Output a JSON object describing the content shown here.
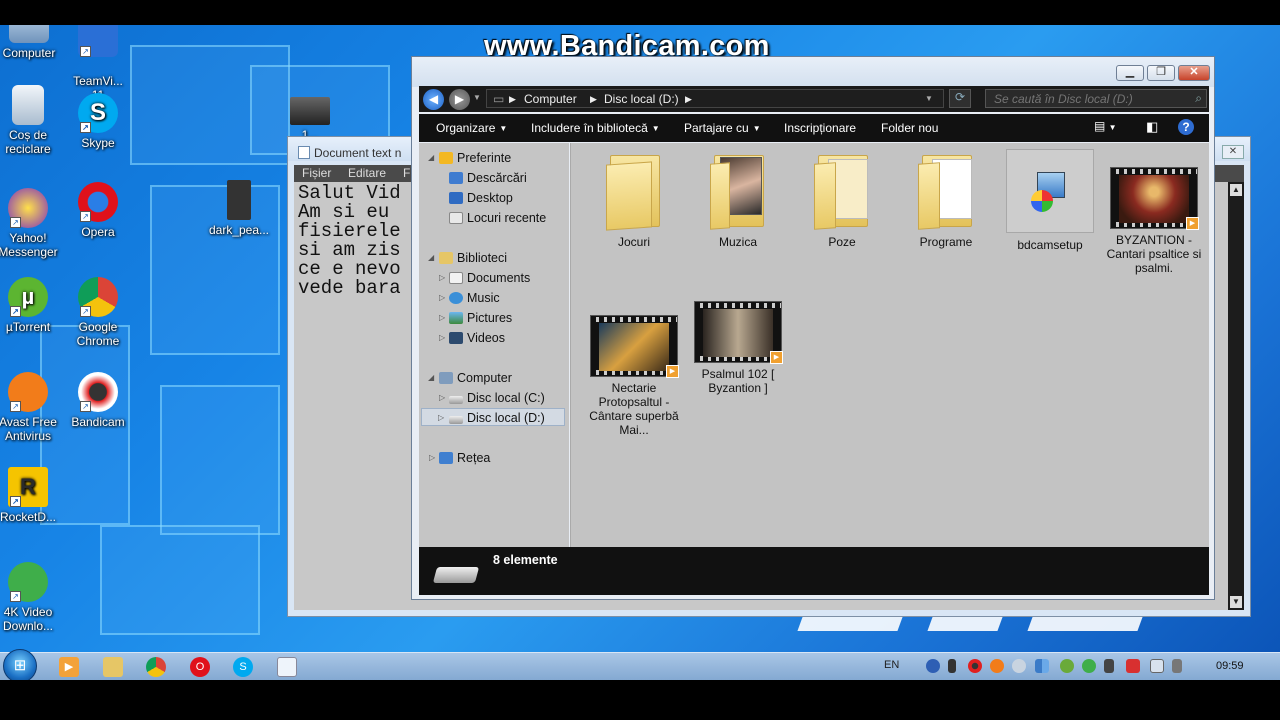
{
  "watermark": "www.Bandicam.com",
  "desktop_icons": [
    {
      "id": "computer",
      "label": "Computer",
      "icon": "computer-icon"
    },
    {
      "id": "teamviewer",
      "label": "TeamVi...\n11",
      "icon": "teamviewer-icon"
    },
    {
      "id": "recycle",
      "label": "Coș de\nreciclare",
      "icon": "recycle-bin-icon"
    },
    {
      "id": "skype",
      "label": "Skype",
      "icon": "skype-icon"
    },
    {
      "id": "yahoo",
      "label": "Yahoo!\nMessenger",
      "icon": "yahoo-messenger-icon"
    },
    {
      "id": "opera",
      "label": "Opera",
      "icon": "opera-icon"
    },
    {
      "id": "darkpea",
      "label": "dark_pea...",
      "icon": "file-icon"
    },
    {
      "id": "utorrent",
      "label": "µTorrent",
      "icon": "utorrent-icon"
    },
    {
      "id": "chrome",
      "label": "Google\nChrome",
      "icon": "chrome-icon"
    },
    {
      "id": "avast",
      "label": "Avast Free\nAntivirus",
      "icon": "avast-icon"
    },
    {
      "id": "bandicam",
      "label": "Bandicam",
      "icon": "bandicam-icon"
    },
    {
      "id": "rocketdock",
      "label": "RocketD...",
      "icon": "rocketdock-icon"
    },
    {
      "id": "4kvideo",
      "label": "4K Video\nDownlo...",
      "icon": "4k-video-downloader-icon"
    },
    {
      "id": "partial",
      "label": "1...",
      "icon": "media-file-icon"
    }
  ],
  "notepad": {
    "title": "Document text n",
    "menu": [
      "Fișier",
      "Editare",
      "F"
    ],
    "text": "Salut Vid\nAm si eu\nfisierele\nsi am zis\nce e nevo\nvede bara"
  },
  "explorer": {
    "breadcrumb": [
      "Computer",
      "Disc local (D:)"
    ],
    "search_placeholder": "Se caută în Disc local (D:)",
    "toolbar": {
      "organize": "Organizare",
      "include": "Includere în bibliotecă",
      "share": "Partajare cu",
      "burn": "Inscripționare",
      "new_folder": "Folder nou"
    },
    "nav": {
      "favorites": "Preferinte",
      "downloads": "Descărcări",
      "desktop": "Desktop",
      "recent": "Locuri recente",
      "libraries": "Biblioteci",
      "documents": "Documents",
      "music": "Music",
      "pictures": "Pictures",
      "videos": "Videos",
      "computer": "Computer",
      "drive_c": "Disc local (C:)",
      "drive_d": "Disc local (D:)",
      "network": "Rețea"
    },
    "items": {
      "jocuri": "Jocuri",
      "muzica": "Muzica",
      "poze": "Poze",
      "programe": "Programe",
      "bdcam": "bdcamsetup",
      "byzantion": "BYZANTION - Cantari psaltice si psalmi.",
      "nectarie": "Nectarie Protopsaltul - Cântare superbă Mai...",
      "psalmul": "Psalmul 102 [ Byzantion ]"
    },
    "status": "8 elemente"
  },
  "tray": {
    "lang": "EN",
    "time": "09:59"
  },
  "colors": {
    "desktop": "#1784e6",
    "explorer_dark": "#111111",
    "taskbar": "#9bbbe0"
  }
}
